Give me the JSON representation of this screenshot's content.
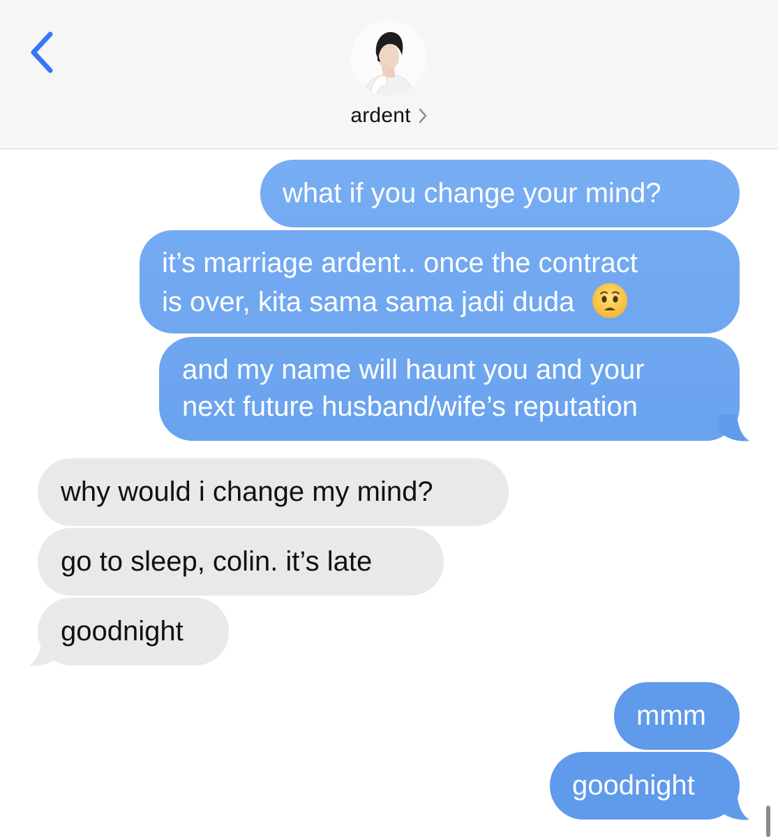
{
  "header": {
    "contact_name": "ardent",
    "icons": {
      "back": "chevron-left-icon",
      "contact_chevron": "chevron-right-icon",
      "avatar": "avatar"
    }
  },
  "messages": [
    {
      "direction": "sent",
      "lines": [
        "what if you change your mind?"
      ]
    },
    {
      "direction": "sent",
      "lines": [
        "it’s marriage ardent.. once the contract",
        "is over, kita sama sama jadi duda"
      ],
      "emoji": "worried-face"
    },
    {
      "direction": "sent",
      "lines": [
        "and my name will haunt you and your",
        "next future husband/wife’s reputation"
      ]
    },
    {
      "direction": "received",
      "lines": [
        "why would i change my mind?"
      ]
    },
    {
      "direction": "received",
      "lines": [
        "go to sleep, colin. it’s late"
      ]
    },
    {
      "direction": "received",
      "lines": [
        "goodnight"
      ]
    },
    {
      "direction": "sent",
      "lines": [
        "mmm"
      ]
    },
    {
      "direction": "sent",
      "lines": [
        "goodnight"
      ]
    }
  ],
  "colors": {
    "sent_bubble_top": "#7fb3f5",
    "sent_bubble_bottom": "#5f9aeb",
    "received_bubble": "#e9e9eb",
    "accent": "#3478f6",
    "header_bg": "#f6f6f6"
  }
}
